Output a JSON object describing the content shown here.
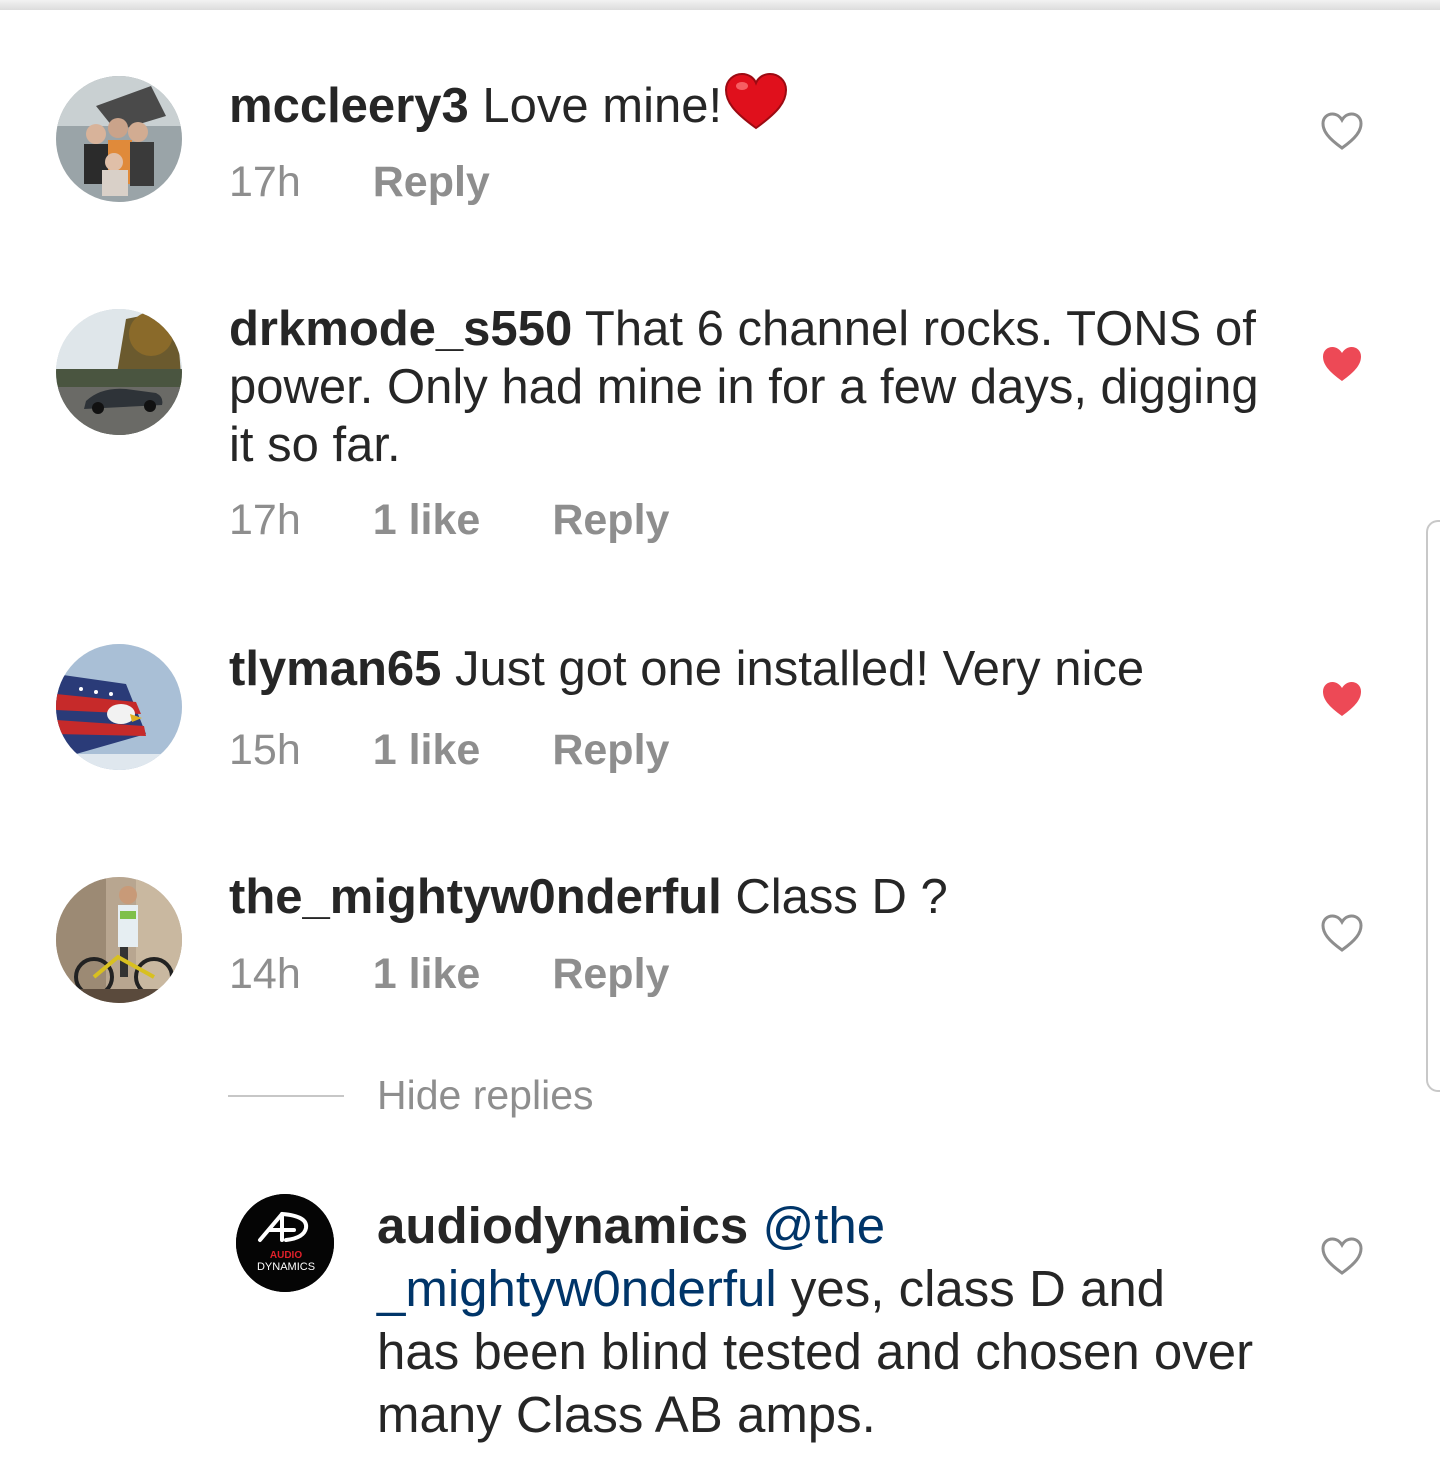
{
  "comments": [
    {
      "username": "mccleery3",
      "text": " Love mine!",
      "time": "17h",
      "likes": "",
      "reply": "Reply",
      "liked": false
    },
    {
      "username": "drkmode_s550",
      "text": " That 6 channel rocks. TONS of power. Only had mine in for a few days, digging it so far.",
      "time": "17h",
      "likes": "1 like",
      "reply": "Reply",
      "liked": true
    },
    {
      "username": "tlyman65",
      "text": " Just got one installed! Very nice",
      "time": "15h",
      "likes": "1 like",
      "reply": "Reply",
      "liked": true
    },
    {
      "username": "the_mightyw0nderful",
      "text": " Class D ?",
      "time": "14h",
      "likes": "1 like",
      "reply": "Reply",
      "liked": false
    }
  ],
  "replies_toggle": "Hide replies",
  "reply": {
    "username": "audiodynamics",
    "mention": " @the _mightyw0nderful",
    "text": " yes, class D and has been blind tested and chosen over many Class AB amps.",
    "liked": false,
    "logo_text_1": "AUDIO",
    "logo_text_2": "DYNAMICS"
  },
  "colors": {
    "liked": "#ed4956",
    "meta": "#8e8e8e",
    "mention": "#003569",
    "text": "#262626"
  }
}
